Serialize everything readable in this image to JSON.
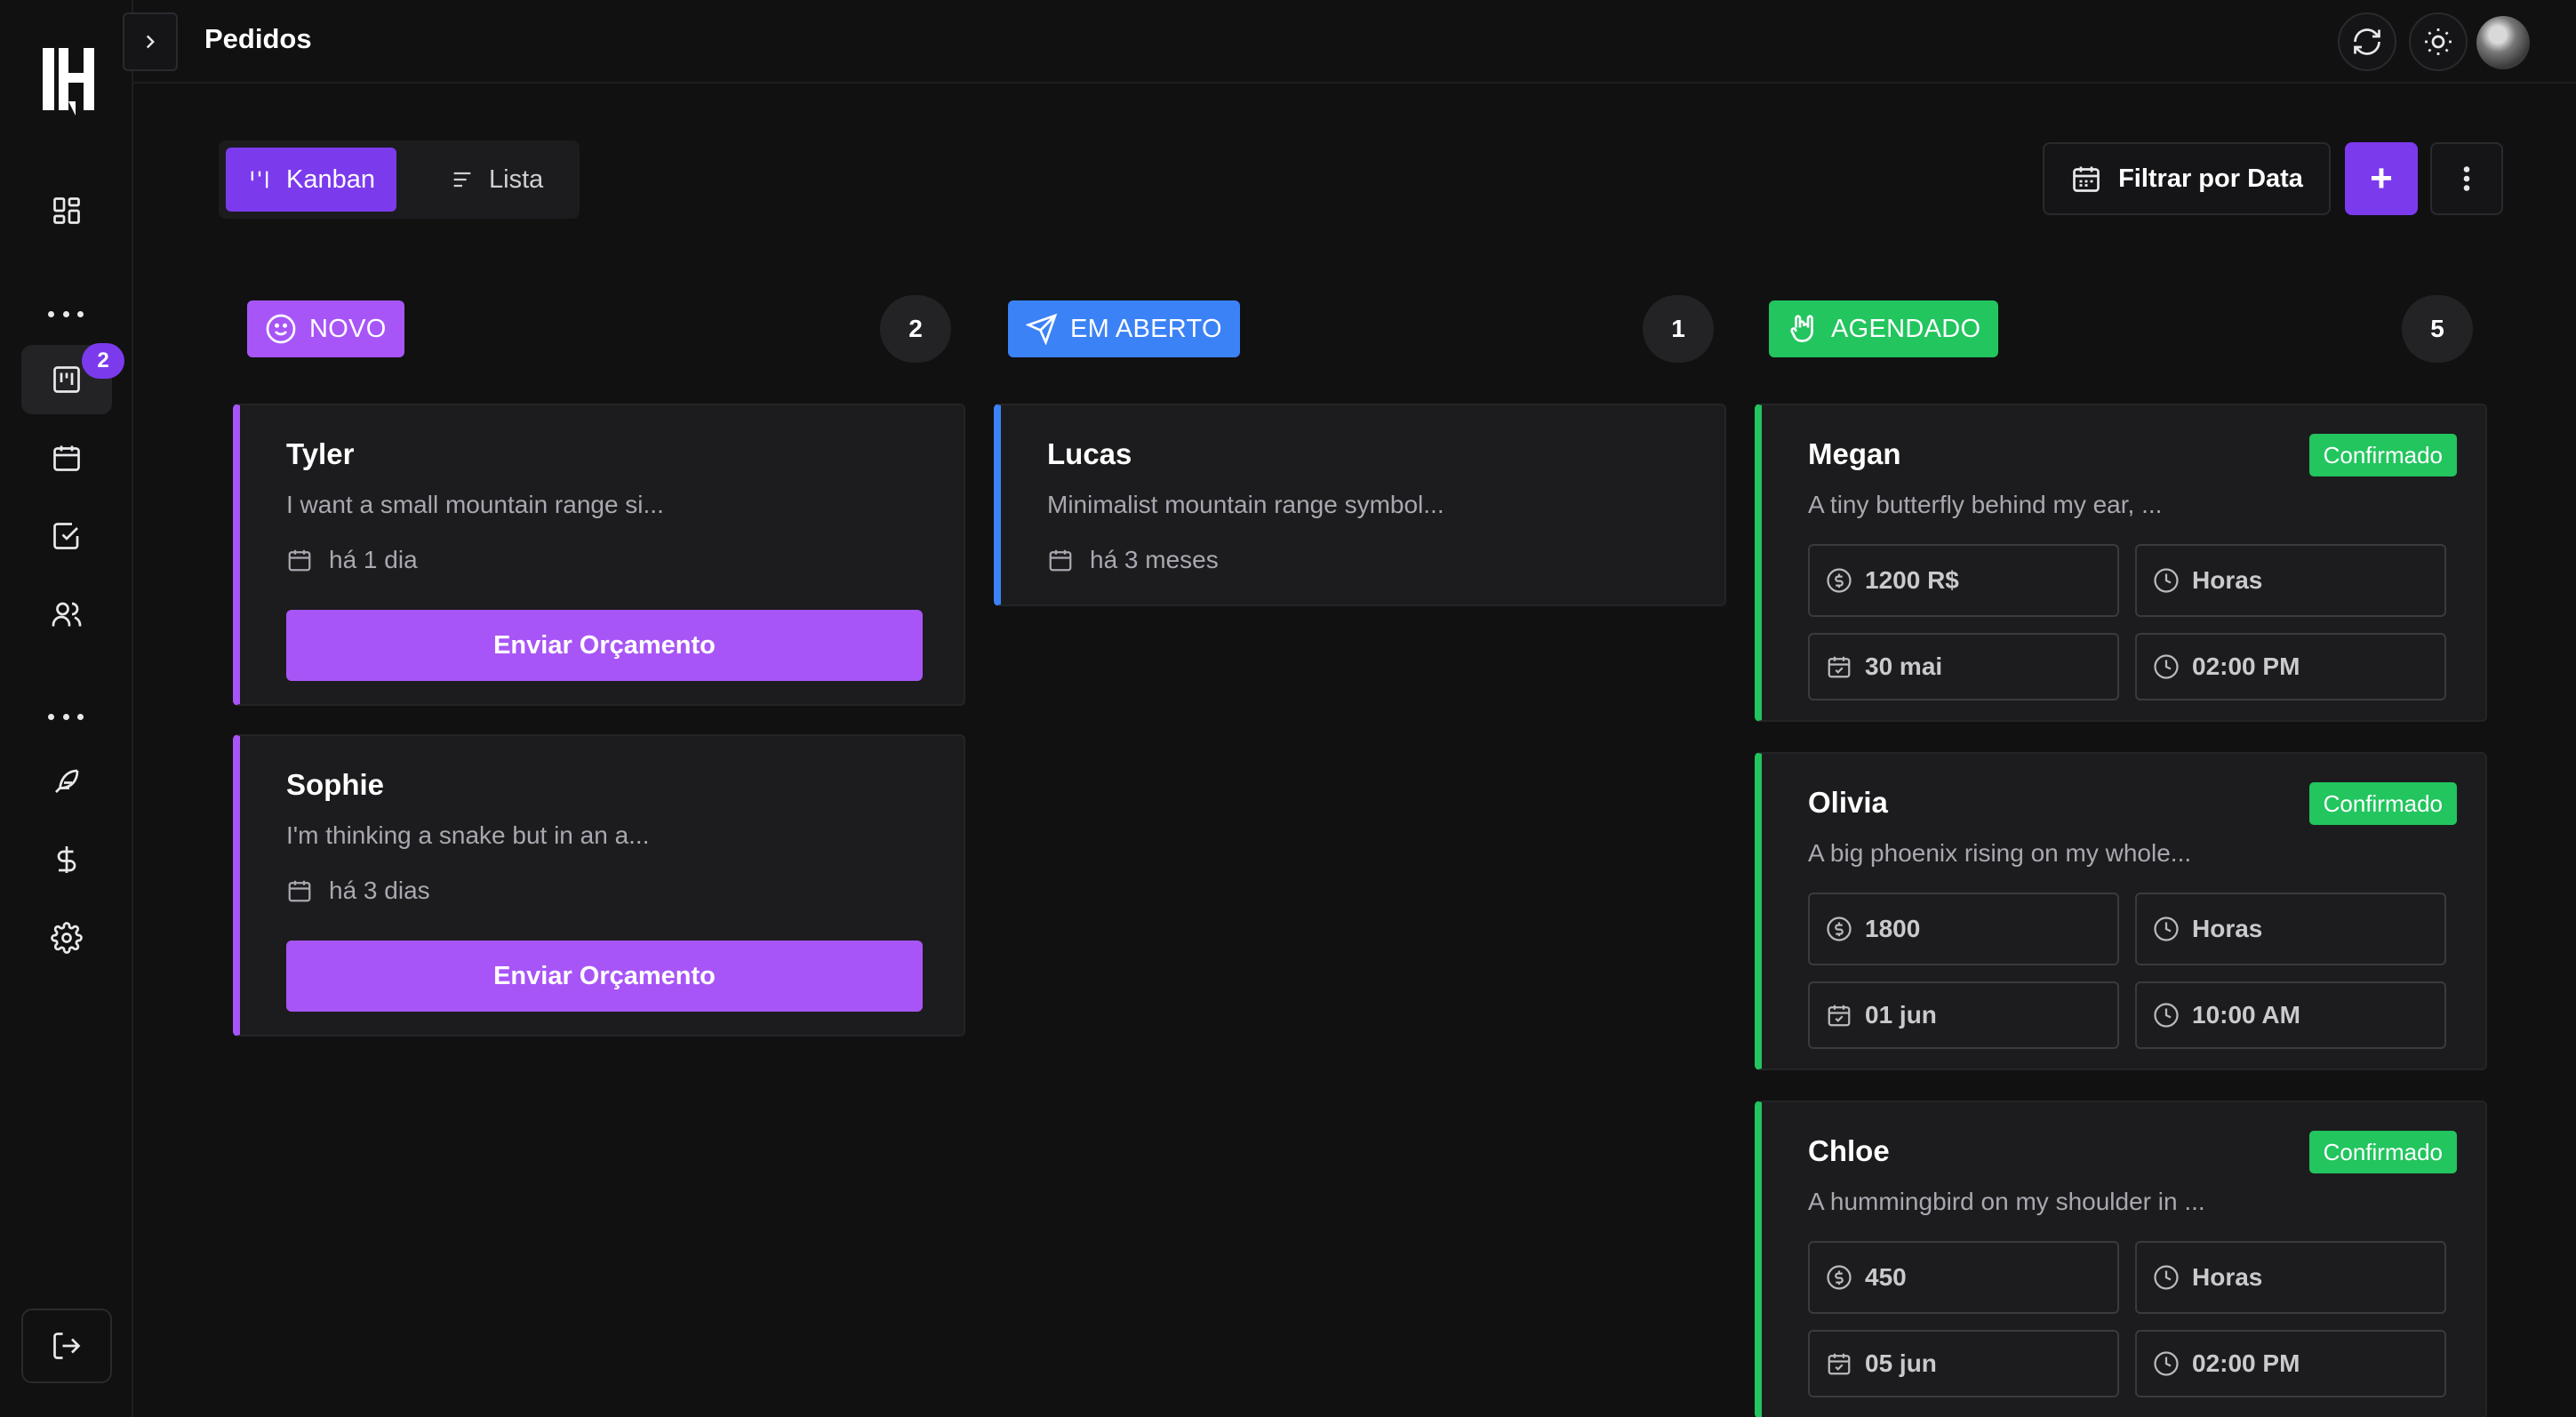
{
  "header": {
    "title": "Pedidos"
  },
  "sidebar": {
    "badge_count": "2"
  },
  "toolbar": {
    "kanban_label": "Kanban",
    "list_label": "Lista",
    "filter_label": "Filtrar por Data",
    "add_label": "+"
  },
  "columns": [
    {
      "label": "NOVO",
      "count": "2",
      "color": "#a855f7",
      "cards": [
        {
          "name": "Tyler",
          "desc": "I want a small mountain range si...",
          "date": "há 1 dia",
          "action": "Enviar Orçamento"
        },
        {
          "name": "Sophie",
          "desc": "I'm thinking a snake but in an a...",
          "date": "há 3 dias",
          "action": "Enviar Orçamento"
        }
      ]
    },
    {
      "label": "EM ABERTO",
      "count": "1",
      "color": "#3b82f6",
      "cards": [
        {
          "name": "Lucas",
          "desc": "Minimalist mountain range symbol...",
          "date": "há 3 meses"
        }
      ]
    },
    {
      "label": "AGENDADO",
      "count": "5",
      "color": "#22c55e",
      "cards": [
        {
          "name": "Megan",
          "status": "Confirmado",
          "desc": "A tiny butterfly behind my ear, ...",
          "price": "1200 R$",
          "duration": "Horas",
          "date": "30 mai",
          "time": "02:00 PM"
        },
        {
          "name": "Olivia",
          "status": "Confirmado",
          "desc": "A big phoenix rising on my whole...",
          "price": "1800",
          "duration": "Horas",
          "date": "01 jun",
          "time": "10:00 AM"
        },
        {
          "name": "Chloe",
          "status": "Confirmado",
          "desc": "A hummingbird on my shoulder in ...",
          "price": "450",
          "duration": "Horas",
          "date": "05 jun",
          "time": "02:00 PM"
        }
      ]
    }
  ]
}
